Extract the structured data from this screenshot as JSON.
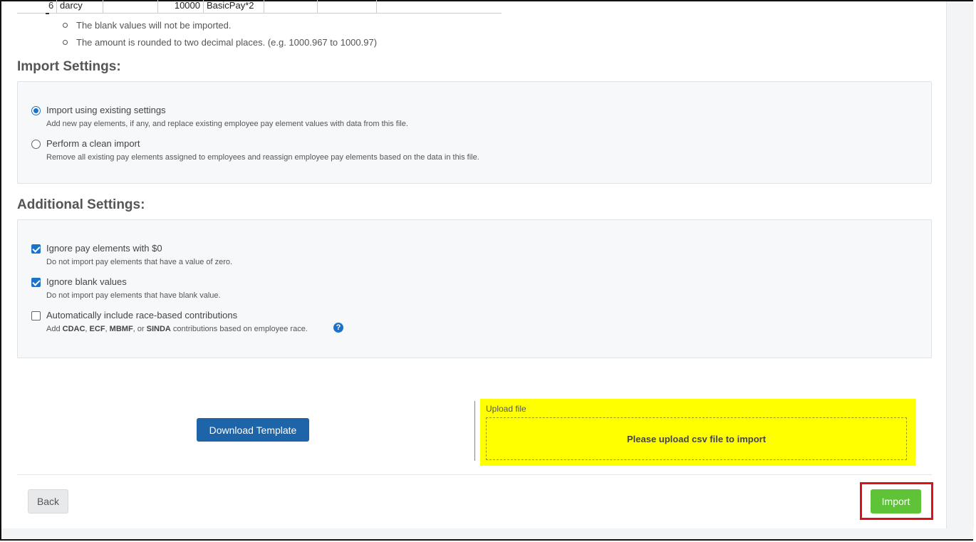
{
  "table_row": {
    "index": "6",
    "name": "darcy",
    "amount": "10000",
    "formula": "BasicPay*2"
  },
  "notes": [
    "The blank values will not be imported.",
    "The amount is rounded to two decimal places. (e.g. 1000.967 to 1000.97)"
  ],
  "import_settings": {
    "title": "Import Settings:",
    "options": [
      {
        "label": "Import using existing settings",
        "desc": "Add new pay elements, if any, and replace existing employee pay element values with data from this file.",
        "selected": true
      },
      {
        "label": "Perform a clean import",
        "desc": "Remove all existing pay elements assigned to employees and reassign employee pay elements based on the data in this file.",
        "selected": false
      }
    ]
  },
  "additional_settings": {
    "title": "Additional Settings:",
    "options": [
      {
        "label": "Ignore pay elements with $0",
        "desc": "Do not import pay elements that have a value of zero.",
        "checked": true
      },
      {
        "label": "Ignore blank values",
        "desc": "Do not import pay elements that have blank value.",
        "checked": true
      },
      {
        "label": "Automatically include race-based contributions",
        "checked": false,
        "desc_parts": {
          "pre": "Add ",
          "cdac": "CDAC",
          "sep1": ", ",
          "ecf": "ECF",
          "sep2": ", ",
          "mbmf": "MBMF",
          "sep3": ", or ",
          "sinda": "SINDA",
          "post": " contributions based on employee race."
        }
      }
    ],
    "help_icon": "question-circle-icon"
  },
  "download_template_label": "Download Template",
  "upload": {
    "label": "Upload file",
    "drop_text": "Please upload csv file to import",
    "highlight_color": "#ffff00"
  },
  "footer": {
    "back_label": "Back",
    "import_label": "Import",
    "import_color": "#5fc338",
    "highlight_border_color": "#e0101a"
  }
}
